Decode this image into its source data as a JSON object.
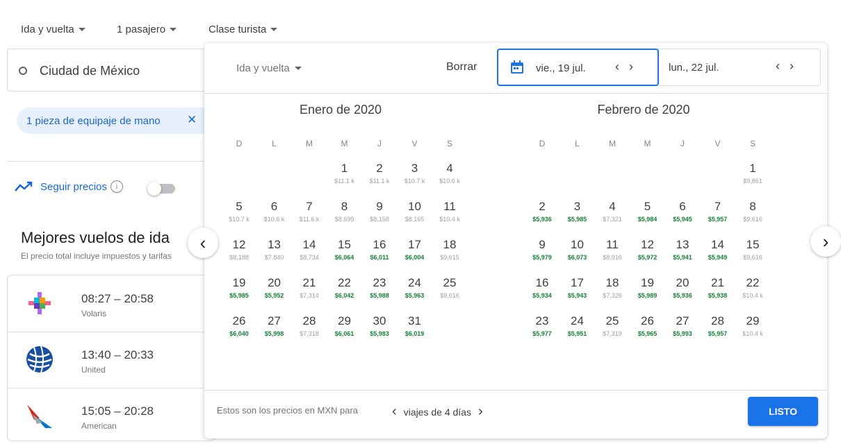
{
  "topbar": {
    "trip_type": "Ida y vuelta",
    "passengers": "1 pasajero",
    "cabin": "Clase turista"
  },
  "search": {
    "origin": "Ciudad de México",
    "chip_label": "1 pieza de equipaje de mano",
    "chip_close": "✕"
  },
  "track": {
    "label": "Seguir precios",
    "info": "i"
  },
  "best": {
    "title": "Mejores vuelos de ida",
    "subtitle": "El precio total incluye impuestos y tarifas"
  },
  "flights": [
    {
      "times": "08:27 – 20:58",
      "airline": "Volaris",
      "logo": "volaris-logo"
    },
    {
      "times": "13:40 – 20:33",
      "airline": "United",
      "logo": "united-logo"
    },
    {
      "times": "15:05 – 20:28",
      "airline": "American",
      "logo": "american-logo"
    }
  ],
  "picker": {
    "trip_type": "Ida y vuelta",
    "clear_label": "Borrar",
    "departure": "vie., 19 jul.",
    "return": "lun., 22 jul.",
    "prev_month": "‹",
    "next_month": "›",
    "footer_text": "Estos son los precios en MXN para",
    "trip_length": "viajes de 4 días",
    "done_label": "LISTO",
    "colors": {
      "accent": "#1a73e8",
      "low_price": "#188038",
      "normal_price": "#9aa0a6"
    }
  },
  "calendar": {
    "weekdays": [
      "D",
      "L",
      "M",
      "M",
      "J",
      "V",
      "S"
    ],
    "months": [
      {
        "title": "Enero de 2020",
        "first_weekday": 3,
        "days": [
          [
            "1",
            "$11.1 k",
            false
          ],
          [
            "2",
            "$11.1 k",
            false
          ],
          [
            "3",
            "$10.7 k",
            false
          ],
          [
            "4",
            "$10.6 k",
            false
          ],
          [
            "5",
            "$10.7 k",
            false
          ],
          [
            "6",
            "$10.6 k",
            false
          ],
          [
            "7",
            "$11.6 k",
            false
          ],
          [
            "8",
            "$8,699",
            false
          ],
          [
            "9",
            "$8,158",
            false
          ],
          [
            "10",
            "$8,165",
            false
          ],
          [
            "11",
            "$10.4 k",
            false
          ],
          [
            "12",
            "$8,188",
            false
          ],
          [
            "13",
            "$7,840",
            false
          ],
          [
            "14",
            "$8,734",
            false
          ],
          [
            "15",
            "$6,064",
            true
          ],
          [
            "16",
            "$6,011",
            true
          ],
          [
            "17",
            "$6,004",
            true
          ],
          [
            "18",
            "$9,615",
            false
          ],
          [
            "19",
            "$5,985",
            true
          ],
          [
            "20",
            "$5,952",
            true
          ],
          [
            "21",
            "$7,314",
            false
          ],
          [
            "22",
            "$6,042",
            true
          ],
          [
            "23",
            "$5,988",
            true
          ],
          [
            "24",
            "$5,963",
            true
          ],
          [
            "25",
            "$9,616",
            false
          ],
          [
            "26",
            "$6,040",
            true
          ],
          [
            "27",
            "$5,998",
            true
          ],
          [
            "28",
            "$7,318",
            false
          ],
          [
            "29",
            "$6,061",
            true
          ],
          [
            "30",
            "$5,983",
            true
          ],
          [
            "31",
            "$6,019",
            true
          ]
        ]
      },
      {
        "title": "Febrero de 2020",
        "first_weekday": 6,
        "days": [
          [
            "1",
            "$9,861",
            false
          ],
          [
            "2",
            "$5,936",
            true
          ],
          [
            "3",
            "$5,985",
            true
          ],
          [
            "4",
            "$7,321",
            false
          ],
          [
            "5",
            "$5,984",
            true
          ],
          [
            "6",
            "$5,945",
            true
          ],
          [
            "7",
            "$5,957",
            true
          ],
          [
            "8",
            "$9,616",
            false
          ],
          [
            "9",
            "$5,979",
            true
          ],
          [
            "10",
            "$6,073",
            true
          ],
          [
            "11",
            "$8,916",
            false
          ],
          [
            "12",
            "$5,972",
            true
          ],
          [
            "13",
            "$5,941",
            true
          ],
          [
            "14",
            "$5,949",
            true
          ],
          [
            "15",
            "$9,616",
            false
          ],
          [
            "16",
            "$5,934",
            true
          ],
          [
            "17",
            "$5,943",
            true
          ],
          [
            "18",
            "$7,326",
            false
          ],
          [
            "19",
            "$5,989",
            true
          ],
          [
            "20",
            "$5,936",
            true
          ],
          [
            "21",
            "$5,938",
            true
          ],
          [
            "22",
            "$10.4 k",
            false
          ],
          [
            "23",
            "$5,977",
            true
          ],
          [
            "24",
            "$5,951",
            true
          ],
          [
            "25",
            "$7,319",
            false
          ],
          [
            "26",
            "$5,965",
            true
          ],
          [
            "27",
            "$5,993",
            true
          ],
          [
            "28",
            "$5,957",
            true
          ],
          [
            "29",
            "$10.4 k",
            false
          ]
        ]
      }
    ]
  }
}
